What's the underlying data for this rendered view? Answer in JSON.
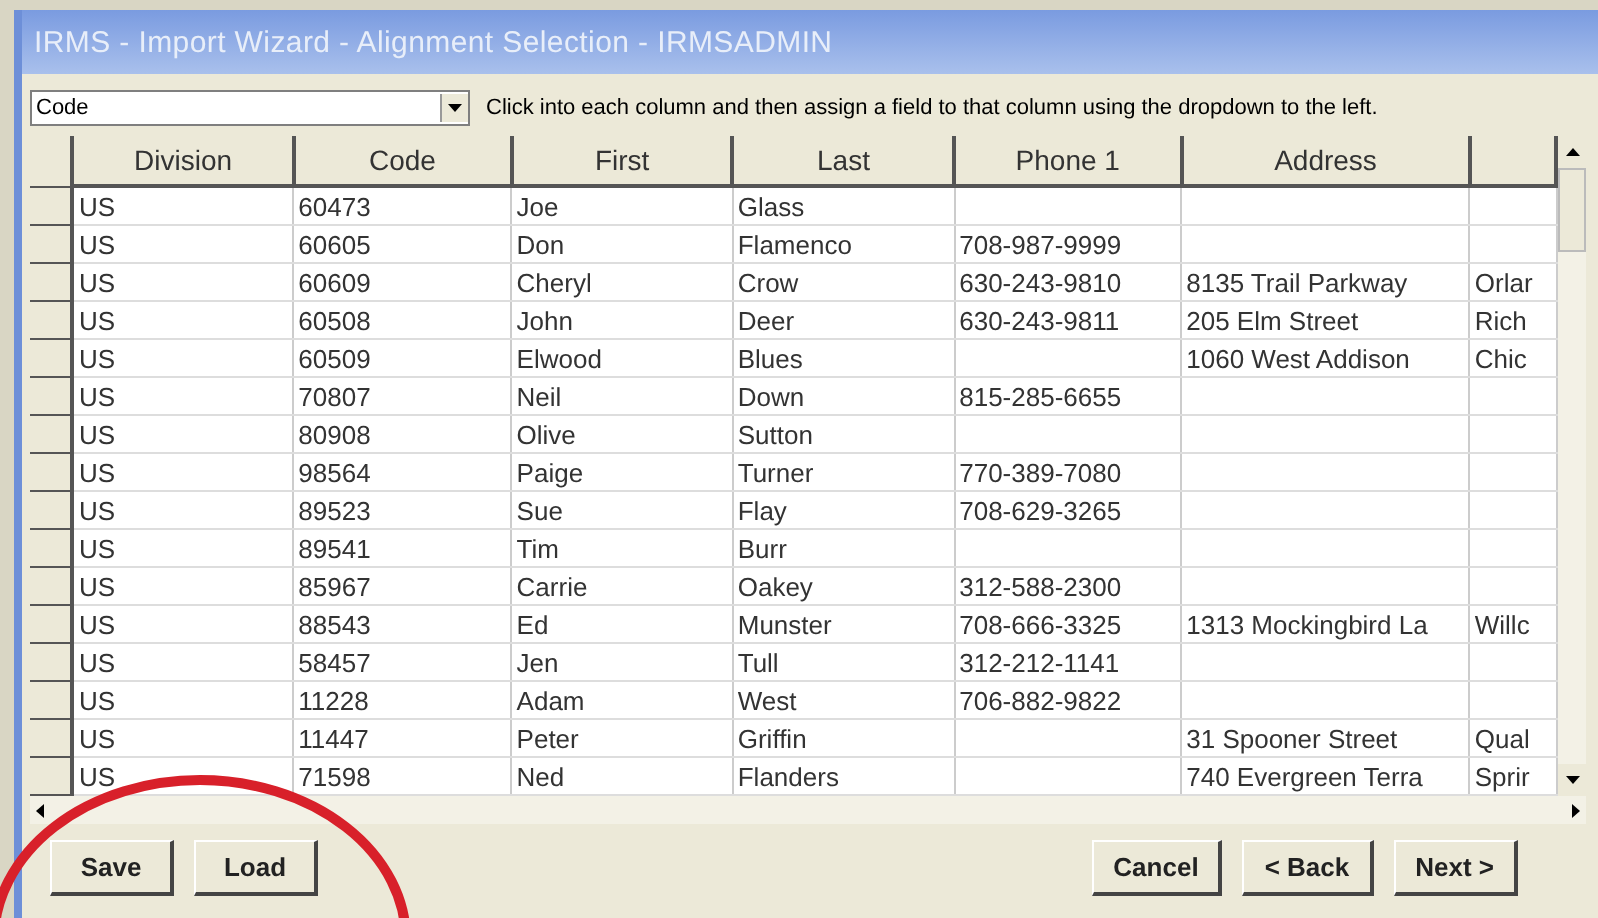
{
  "window": {
    "title": "IRMS - Import Wizard - Alignment Selection - IRMSADMIN"
  },
  "field_select": {
    "value": "Code"
  },
  "instruction": "Click into each column and then assign a field to that column using the dropdown to the left.",
  "table": {
    "columns": [
      "Division",
      "Code",
      "First",
      "Last",
      "Phone 1",
      "Address"
    ],
    "rows": [
      {
        "division": "US",
        "code": "60473",
        "first": "Joe",
        "last": "Glass"
      },
      {
        "division": "US",
        "code": "60605",
        "first": "Don",
        "last": "Flamenco",
        "phone_1": "708-987-9999"
      },
      {
        "division": "US",
        "code": "60609",
        "first": "Cheryl",
        "last": "Crow",
        "phone_1": "630-243-9810",
        "address": "8135 Trail Parkway",
        "column_7": "Orlar"
      },
      {
        "division": "US",
        "code": "60508",
        "first": "John",
        "last": "Deer",
        "phone_1": "630-243-9811",
        "address": "205 Elm Street",
        "column_7": "Rich"
      },
      {
        "division": "US",
        "code": "60509",
        "first": "Elwood",
        "last": "Blues",
        "address": "1060 West Addison",
        "column_7": "Chic"
      },
      {
        "division": "US",
        "code": "70807",
        "first": "Neil",
        "last": "Down",
        "phone_1": "815-285-6655"
      },
      {
        "division": "US",
        "code": "80908",
        "first": "Olive",
        "last": "Sutton"
      },
      {
        "division": "US",
        "code": "98564",
        "first": "Paige",
        "last": "Turner",
        "phone_1": "770-389-7080"
      },
      {
        "division": "US",
        "code": "89523",
        "first": "Sue",
        "last": "Flay",
        "phone_1": "708-629-3265"
      },
      {
        "division": "US",
        "code": "89541",
        "first": "Tim",
        "last": "Burr"
      },
      {
        "division": "US",
        "code": "85967",
        "first": "Carrie",
        "last": "Oakey",
        "phone_1": "312-588-2300"
      },
      {
        "division": "US",
        "code": "88543",
        "first": "Ed",
        "last": "Munster",
        "phone_1": "708-666-3325",
        "address": "1313 Mockingbird La",
        "column_7": "Willc"
      },
      {
        "division": "US",
        "code": "58457",
        "first": "Jen",
        "last": "Tull",
        "phone_1": "312-212-1141"
      },
      {
        "division": "US",
        "code": "11228",
        "first": "Adam",
        "last": "West",
        "phone_1": "706-882-9822"
      },
      {
        "division": "US",
        "code": "11447",
        "first": "Peter",
        "last": "Griffin",
        "address": "31 Spooner Street",
        "column_7": "Qual"
      },
      {
        "division": "US",
        "code": "71598",
        "first": "Ned",
        "last": "Flanders",
        "address": "740 Evergreen Terra",
        "column_7": "Sprir"
      }
    ]
  },
  "buttons_left": [
    {
      "label": "Save"
    },
    {
      "label": "Load"
    }
  ],
  "buttons_right": [
    {
      "label": "Cancel"
    },
    {
      "label": "< Back"
    },
    {
      "label": "Next >"
    }
  ]
}
